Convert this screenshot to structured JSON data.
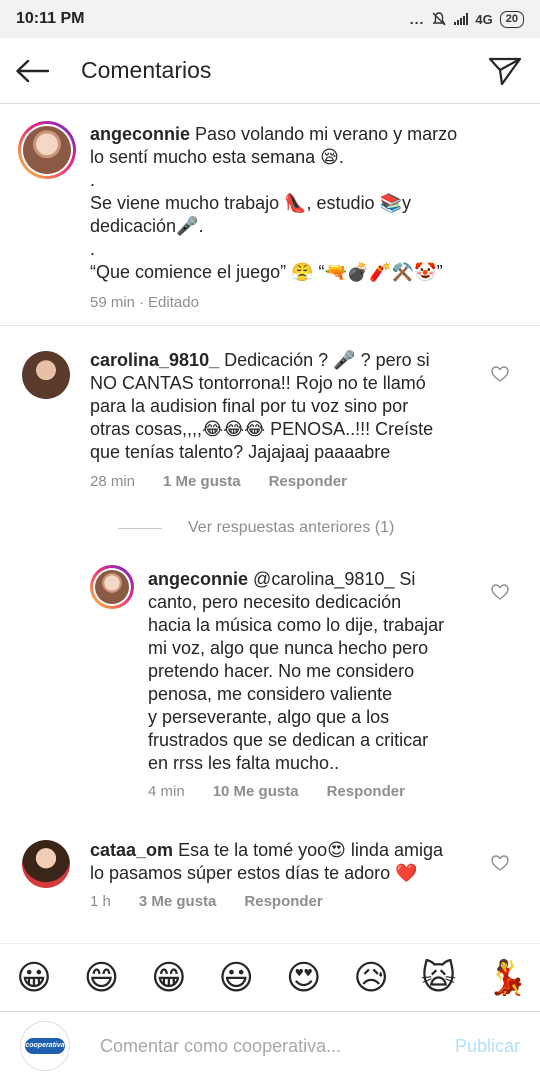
{
  "status_bar": {
    "time": "10:11 PM",
    "dots": "...",
    "network": "4G",
    "battery": "20"
  },
  "header": {
    "title": "Comentarios"
  },
  "caption": {
    "username": "angeconnie",
    "lines": [
      "Paso volando mi verano y marzo",
      "lo sentí mucho esta semana 😪.",
      ".",
      "Se viene mucho trabajo 👠, estudio 📚y",
      "dedicación🎤.",
      ".",
      "“Que comience el juego” 😤 “🔫💣🧨⚒️🤡”"
    ],
    "time": "59 min",
    "edited": "Editado"
  },
  "comments": [
    {
      "username": "carolina_9810_",
      "lines": [
        "Dedicación ? 🎤 ? pero si",
        "NO CANTAS tontorrona!! Rojo no te llamó",
        "para la audision final por tu voz sino por",
        "otras cosas,,,,😂😂😂 PENOSA..!!! Creíste",
        "que tenías talento? Jajajaaj paaaabre"
      ],
      "time": "28 min",
      "likes": "1 Me gusta",
      "reply": "Responder"
    },
    {
      "username": "angeconnie",
      "lines": [
        "@carolina_9810_  Si",
        "canto, pero necesito dedicación",
        "hacia la música como lo dije, trabajar",
        "mi voz, algo que nunca hecho pero",
        "pretendo hacer. No me considero",
        "penosa, me considero valiente",
        "y perseverante, algo que a los",
        "frustrados que se dedican a criticar",
        "en rrss les falta mucho.."
      ],
      "time": "4 min",
      "likes": "10 Me gusta",
      "reply": "Responder"
    },
    {
      "username": "cataa_om",
      "lines": [
        "Esa te la tomé yoo😍 linda amiga",
        "lo pasamos súper estos días te adoro ❤️"
      ],
      "time": "1 h",
      "likes": "3 Me gusta",
      "reply": "Responder"
    }
  ],
  "view_previous": "Ver respuestas anteriores (1)",
  "emoji_bar": [
    "😀",
    "😄",
    "😁",
    "😃",
    "😍",
    "😥",
    "🙀",
    "💃"
  ],
  "input": {
    "placeholder": "Comentar como cooperativa...",
    "publish": "Publicar",
    "avatar_text": "cooperativa"
  },
  "colors": {
    "primary_text": "#262626",
    "secondary_text": "#8e8e8e",
    "publish_disabled": "#b2dffc",
    "story_ring_start": "#f9ce34",
    "story_ring_end": "#6228d7"
  },
  "icons": {
    "back": "arrow-left-icon",
    "send": "paper-plane-icon",
    "like": "heart-outline-icon"
  }
}
